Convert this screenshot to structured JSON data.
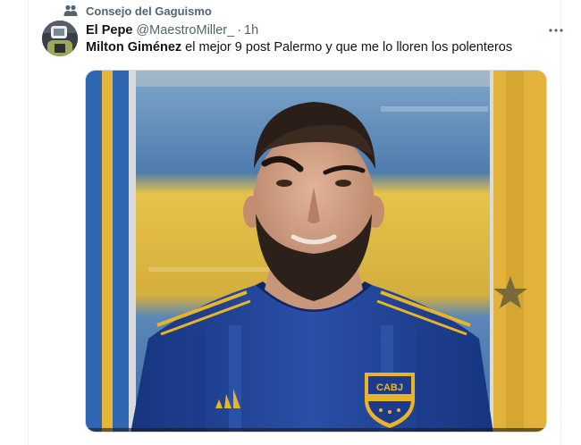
{
  "social_context": {
    "icon": "community-icon",
    "label": "Consejo del Gaguismo"
  },
  "tweet": {
    "display_name": "El Pepe",
    "handle": "@MaestroMiller_",
    "separator": "·",
    "time": "1h",
    "text_bold": "Milton Giménez",
    "text_rest": " el mejor 9 post Palermo y que me lo lloren los polenteros",
    "more_icon": "ellipsis-icon"
  },
  "media": {
    "crest_text": "CABJ",
    "colors": {
      "jersey_blue": "#1c3a8c",
      "jersey_gold": "#e8b52a",
      "flag_yellow": "#e9c23a",
      "flag_blue": "#3f6fb0"
    }
  }
}
